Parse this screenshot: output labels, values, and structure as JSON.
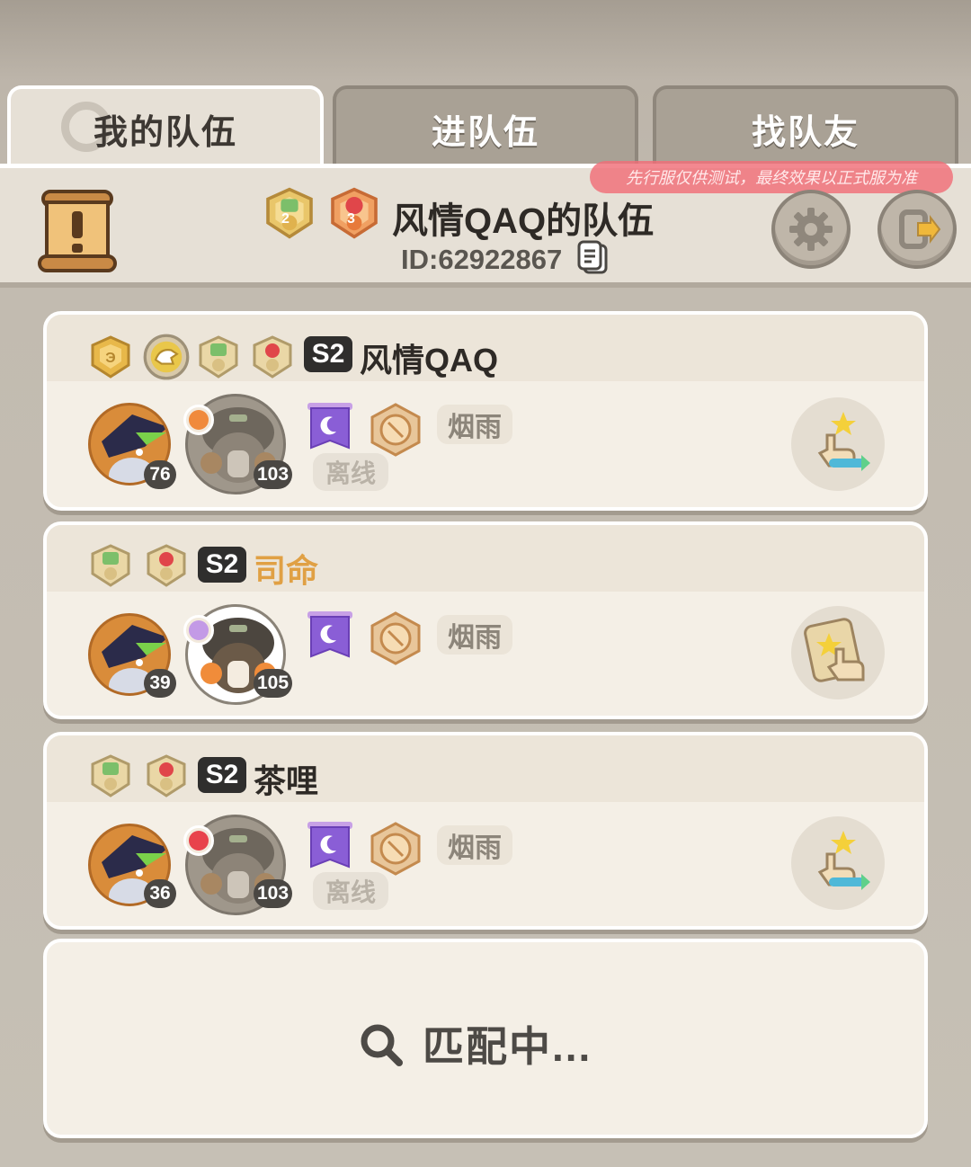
{
  "tabs": [
    {
      "label": "我的队伍",
      "active": true
    },
    {
      "label": "进队伍",
      "active": false
    },
    {
      "label": "找队友",
      "active": false
    }
  ],
  "header": {
    "notice": "先行服仅供测试，最终效果以正式服为准",
    "team_name": "风情QAQ的队伍",
    "team_id": "ID:62922867",
    "badge_numbers": [
      "2",
      "3"
    ]
  },
  "members": [
    {
      "season": "S2",
      "name": "风情QAQ",
      "name_color": "#2e2a26",
      "badges": [
        "shield-badge",
        "dino-badge",
        "rank-badge-1",
        "rank-badge-3"
      ],
      "pet_level": "76",
      "trainer_level": "103",
      "guild": "烟雨",
      "status": "离线",
      "action_icon": "swap-pointer-icon"
    },
    {
      "season": "S2",
      "name": "司命",
      "name_color": "#e0a044",
      "badges": [
        "rank-badge-1",
        "rank-badge-3"
      ],
      "pet_level": "39",
      "trainer_level": "105",
      "guild": "烟雨",
      "status": "",
      "action_icon": "card-pointer-icon"
    },
    {
      "season": "S2",
      "name": "茶哩",
      "name_color": "#2e2a26",
      "badges": [
        "rank-badge-1",
        "rank-badge-3"
      ],
      "pet_level": "36",
      "trainer_level": "103",
      "guild": "烟雨",
      "status": "离线",
      "action_icon": "swap-pointer-icon"
    }
  ],
  "matching": {
    "label": "匹配中..."
  },
  "colors": {
    "background": "#c2bbb0",
    "card": "#f4efe6",
    "notice": "#f06e78",
    "highlight_name": "#e0a044"
  }
}
